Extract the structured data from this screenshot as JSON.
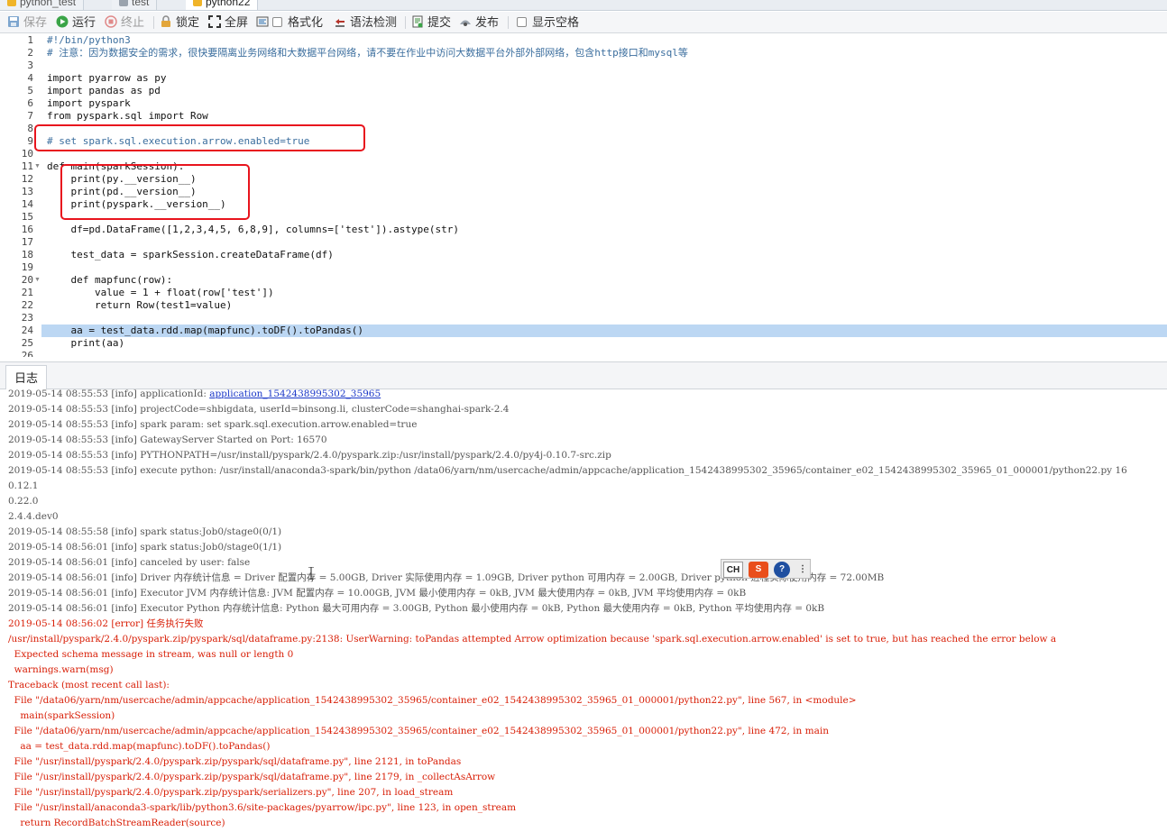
{
  "tabs": [
    {
      "label": "python_test"
    },
    {
      "label": "test"
    },
    {
      "label": "python22"
    }
  ],
  "toolbar": {
    "save": "保存",
    "run": "运行",
    "stop": "终止",
    "lock": "锁定",
    "fullscreen": "全屏",
    "format": "格式化",
    "syntax_check": "语法检测",
    "submit": "提交",
    "publish": "发布",
    "show_whitespace": "显示空格"
  },
  "editor": {
    "lines": [
      "#!/bin/python3",
      "# 注意：因为数据安全的需求，很快要隔离业务网络和大数据平台网络，请不要在作业中访问大数据平台外部外部网络，包含http接口和mysql等",
      "",
      "import pyarrow as py",
      "import pandas as pd",
      "import pyspark",
      "from pyspark.sql import Row",
      "",
      "# set spark.sql.execution.arrow.enabled=true",
      "",
      "def main(sparkSession):",
      "    print(py.__version__)",
      "    print(pd.__version__)",
      "    print(pyspark.__version__)",
      "",
      "    df=pd.DataFrame([1,2,3,4,5, 6,8,9], columns=['test']).astype(str)",
      "",
      "    test_data = sparkSession.createDataFrame(df)",
      "",
      "    def mapfunc(row):",
      "        value = 1 + float(row['test'])",
      "        return Row(test1=value)",
      "",
      "    aa = test_data.rdd.map(mapfunc).toDF().toPandas()",
      "    print(aa)",
      ""
    ],
    "line_numbers": [
      "1",
      "2",
      "3",
      "4",
      "5",
      "6",
      "7",
      "8",
      "9",
      "10",
      "11",
      "12",
      "13",
      "14",
      "15",
      "16",
      "17",
      "18",
      "19",
      "20",
      "21",
      "22",
      "23",
      "24",
      "25",
      "26"
    ],
    "highlighted_line": 24
  },
  "log": {
    "tab_label": "日志",
    "lines": [
      {
        "text": "2019-05-14 08:55:53 [info] applicationId: ",
        "link": "application_1542438995302_35965",
        "type": "info"
      },
      {
        "text": "2019-05-14 08:55:53 [info] projectCode=shbigdata, userId=binsong.li, clusterCode=shanghai-spark-2.4",
        "type": "info"
      },
      {
        "text": "2019-05-14 08:55:53 [info] spark param: set spark.sql.execution.arrow.enabled=true",
        "type": "info"
      },
      {
        "text": "2019-05-14 08:55:53 [info] GatewayServer Started on Port: 16570",
        "type": "info"
      },
      {
        "text": "2019-05-14 08:55:53 [info] PYTHONPATH=/usr/install/pyspark/2.4.0/pyspark.zip:/usr/install/pyspark/2.4.0/py4j-0.10.7-src.zip",
        "type": "info"
      },
      {
        "text": "2019-05-14 08:55:53 [info] execute python: /usr/install/anaconda3-spark/bin/python /data06/yarn/nm/usercache/admin/appcache/application_1542438995302_35965/container_e02_1542438995302_35965_01_000001/python22.py 16",
        "type": "info"
      },
      {
        "text": "0.12.1",
        "type": "info"
      },
      {
        "text": "0.22.0",
        "type": "info"
      },
      {
        "text": "2.4.4.dev0",
        "type": "info"
      },
      {
        "text": "2019-05-14 08:55:58 [info] spark status:Job0/stage0(0/1)",
        "type": "info"
      },
      {
        "text": "2019-05-14 08:56:01 [info] spark status:Job0/stage0(1/1)",
        "type": "info"
      },
      {
        "text": "2019-05-14 08:56:01 [info] canceled by user: false",
        "type": "info"
      },
      {
        "text": "2019-05-14 08:56:01 [info] Driver 内存统计信息 = Driver 配置内存 = 5.00GB, Driver 实际使用内存 = 1.09GB, Driver python 可用内存 = 2.00GB, Driver python 进程实际使用内存 = 72.00MB",
        "type": "info"
      },
      {
        "text": "2019-05-14 08:56:01 [info] Executor JVM 内存统计信息: JVM 配置内存 = 10.00GB, JVM 最小使用内存 = 0kB, JVM 最大使用内存 = 0kB, JVM 平均使用内存 = 0kB",
        "type": "info"
      },
      {
        "text": "2019-05-14 08:56:01 [info] Executor Python 内存统计信息: Python 最大可用内存 = 3.00GB, Python 最小使用内存 = 0kB, Python 最大使用内存 = 0kB, Python 平均使用内存 = 0kB",
        "type": "info"
      },
      {
        "text": "2019-05-14 08:56:02 [error] 任务执行失败",
        "type": "error"
      },
      {
        "text": "/usr/install/pyspark/2.4.0/pyspark.zip/pyspark/sql/dataframe.py:2138: UserWarning: toPandas attempted Arrow optimization because 'spark.sql.execution.arrow.enabled' is set to true, but has reached the error below a",
        "type": "error"
      },
      {
        "text": "  Expected schema message in stream, was null or length 0",
        "type": "error"
      },
      {
        "text": "  warnings.warn(msg)",
        "type": "error"
      },
      {
        "text": "Traceback (most recent call last):",
        "type": "error"
      },
      {
        "text": "  File \"/data06/yarn/nm/usercache/admin/appcache/application_1542438995302_35965/container_e02_1542438995302_35965_01_000001/python22.py\", line 567, in <module>",
        "type": "error"
      },
      {
        "text": "    main(sparkSession)",
        "type": "error"
      },
      {
        "text": "  File \"/data06/yarn/nm/usercache/admin/appcache/application_1542438995302_35965/container_e02_1542438995302_35965_01_000001/python22.py\", line 472, in main",
        "type": "error"
      },
      {
        "text": "    aa = test_data.rdd.map(mapfunc).toDF().toPandas()",
        "type": "error"
      },
      {
        "text": "  File \"/usr/install/pyspark/2.4.0/pyspark.zip/pyspark/sql/dataframe.py\", line 2121, in toPandas",
        "type": "error"
      },
      {
        "text": "  File \"/usr/install/pyspark/2.4.0/pyspark.zip/pyspark/sql/dataframe.py\", line 2179, in _collectAsArrow",
        "type": "error"
      },
      {
        "text": "  File \"/usr/install/pyspark/2.4.0/pyspark.zip/pyspark/serializers.py\", line 207, in load_stream",
        "type": "error"
      },
      {
        "text": "  File \"/usr/install/anaconda3-spark/lib/python3.6/site-packages/pyarrow/ipc.py\", line 123, in open_stream",
        "type": "error"
      },
      {
        "text": "    return RecordBatchStreamReader(source)",
        "type": "error"
      }
    ]
  },
  "ime_toolbar": {
    "lang": "CH",
    "logo": "S",
    "help": "?",
    "more": "⋮"
  },
  "colors": {
    "annotation_red": "#e8141d",
    "error_text": "#d81e06",
    "info_text": "#555555",
    "line_highlight": "#bcd7f3"
  }
}
